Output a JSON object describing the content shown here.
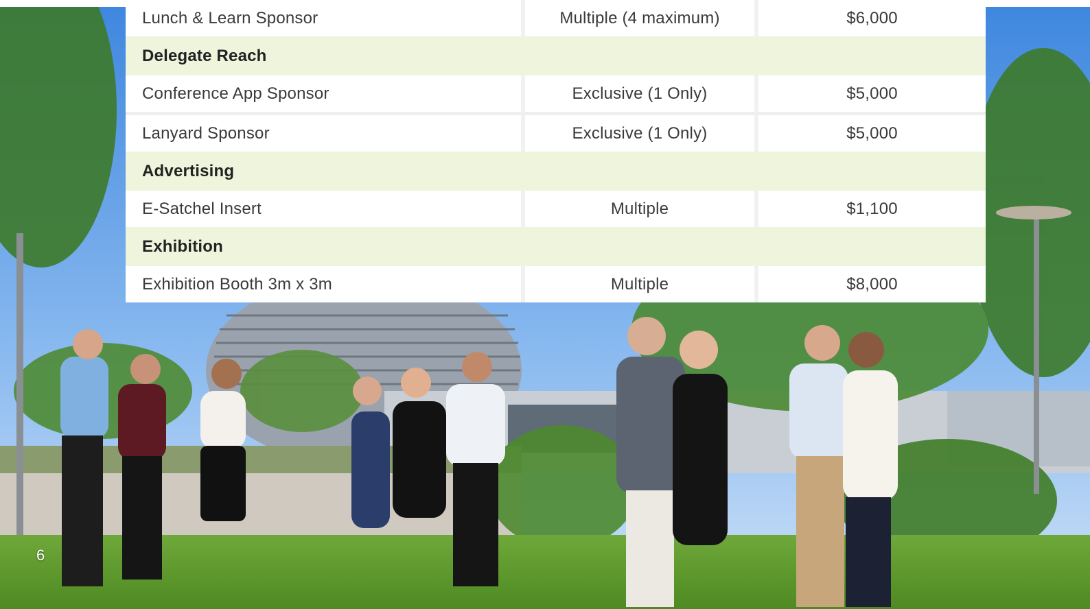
{
  "pricing_table": {
    "rows": [
      {
        "type": "item",
        "name": "Lunch & Learn Sponsor",
        "availability": "Multiple (4 maximum)",
        "price": "$6,000"
      },
      {
        "type": "category",
        "name": "Delegate Reach"
      },
      {
        "type": "item",
        "name": "Conference App Sponsor",
        "availability": "Exclusive (1 Only)",
        "price": "$5,000"
      },
      {
        "type": "item",
        "name": "Lanyard Sponsor",
        "availability": "Exclusive (1 Only)",
        "price": "$5,000"
      },
      {
        "type": "category",
        "name": "Advertising"
      },
      {
        "type": "item",
        "name": "E-Satchel Insert",
        "availability": "Multiple",
        "price": "$1,100"
      },
      {
        "type": "category",
        "name": "Exhibition"
      },
      {
        "type": "item",
        "name": "Exhibition Booth 3m x 3m",
        "availability": "Multiple",
        "price": "$8,000"
      }
    ]
  },
  "page_number": "6",
  "colors": {
    "category_row_bg": "#eff4dd",
    "item_row_bg": "#ffffff",
    "text_dark": "#222222",
    "text_body": "#3a3a3a"
  }
}
